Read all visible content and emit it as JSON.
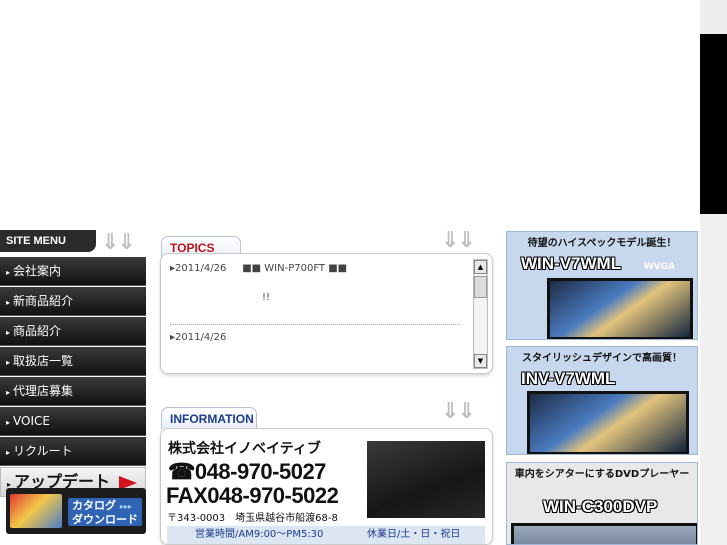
{
  "site_menu": {
    "title": "SITE MENU",
    "items": [
      "会社案内",
      "新商品紹介",
      "商品紹介",
      "取扱店一覧",
      "代理店募集",
      "VOICE",
      "リクルート"
    ],
    "update_label": "アップデート",
    "catalog_label_1": "カタログ",
    "catalog_label_2": "ダウンロード",
    "catalog_arrows": "▸▸▸"
  },
  "topics": {
    "title": "TOPICS",
    "entries": [
      {
        "date": "2011/4/26",
        "text": "■■ WIN-P700FT ■■",
        "note": "!!"
      },
      {
        "date": "2011/4/26",
        "text": ""
      }
    ]
  },
  "information": {
    "title": "INFORMATION",
    "company": "株式会社イノベイティブ",
    "phone": "048-970-5027",
    "fax_label": "FAX",
    "fax": "048-970-5022",
    "address": "〒343-0003　埼玉県越谷市船渡68-8",
    "hours": "営業時間/AM9:00～PM5:30",
    "holidays": "休業日/土・日・祝日"
  },
  "banners": [
    {
      "caption": "待望のハイスペックモデル誕生！",
      "model": "WIN-V7WML",
      "badge": "WVGA"
    },
    {
      "caption": "スタイリッシュデザインで高画質！",
      "model": "INV-V7WML"
    },
    {
      "caption": "車内をシアターにするDVDプレーヤー",
      "model": "WIN-C300DVP"
    }
  ],
  "colors": {
    "topics_accent": "#c0121b",
    "info_accent": "#1b3c8f",
    "update_arrow": "#d0121b"
  },
  "icons": {
    "menu_bullet": "▸",
    "scroll_up": "▲",
    "scroll_down": "▼",
    "down_arrows": "⇓⇓",
    "phone": "☎"
  }
}
